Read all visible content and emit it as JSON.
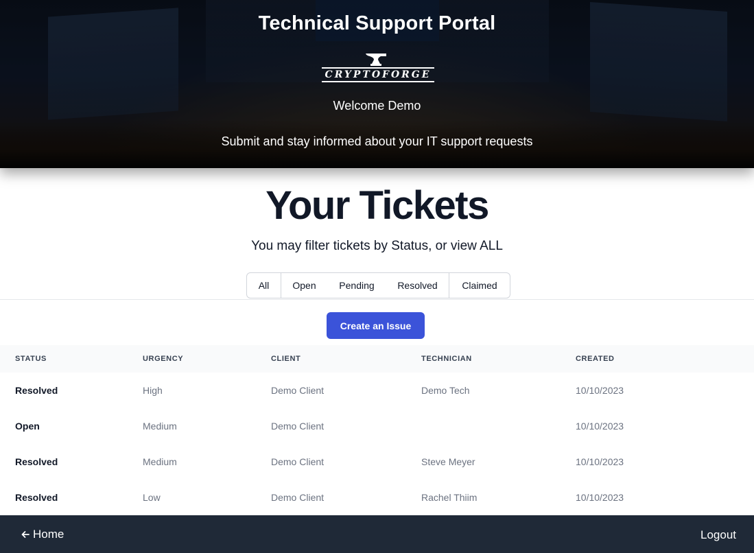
{
  "hero": {
    "title": "Technical Support Portal",
    "logo_text": "CRYPTOFORGE",
    "welcome": "Welcome Demo",
    "subtitle": "Submit and stay informed about your IT support requests"
  },
  "main": {
    "title": "Your Tickets",
    "subtitle": "You may filter tickets by Status, or view ALL",
    "filters": [
      "All",
      "Open",
      "Pending",
      "Resolved",
      "Claimed"
    ],
    "create_button": "Create an Issue"
  },
  "table": {
    "headers": [
      "STATUS",
      "URGENCY",
      "CLIENT",
      "TECHNICIAN",
      "CREATED"
    ],
    "rows": [
      [
        "Resolved",
        "High",
        "Demo Client",
        "Demo Tech",
        "10/10/2023"
      ],
      [
        "Open",
        "Medium",
        "Demo Client",
        "",
        "10/10/2023"
      ],
      [
        "Resolved",
        "Medium",
        "Demo Client",
        "Steve Meyer",
        "10/10/2023"
      ],
      [
        "Resolved",
        "Low",
        "Demo Client",
        "Rachel Thiim",
        "10/10/2023"
      ]
    ]
  },
  "footer": {
    "home_label": "Home",
    "home_icon": "arrow-left-icon",
    "logout_label": "Logout"
  },
  "colors": {
    "primary_button": "#3b53d9",
    "footer_bg": "#1f2937"
  }
}
